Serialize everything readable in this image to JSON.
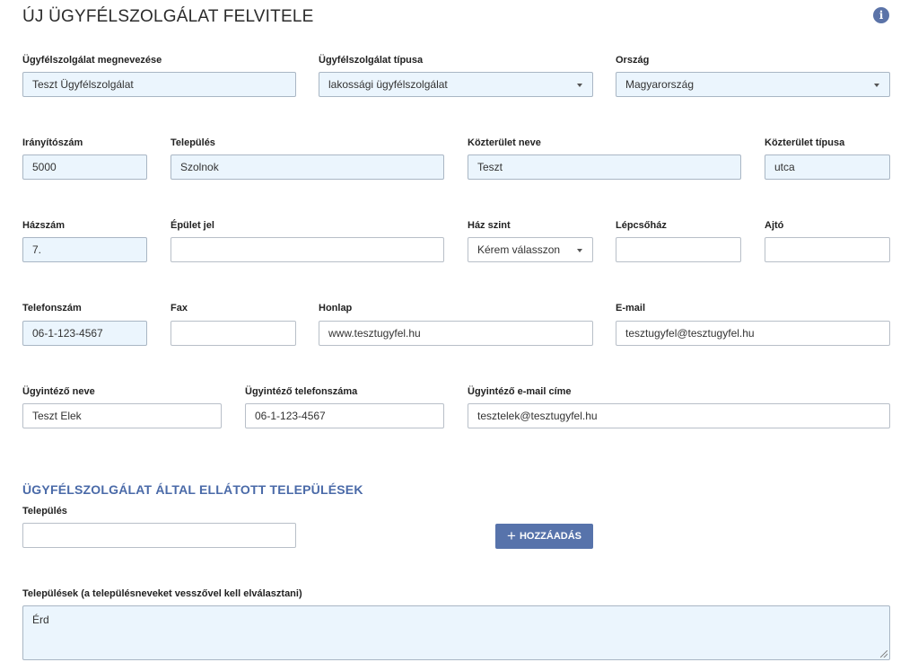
{
  "header": {
    "title": "ÚJ ÜGYFÉLSZOLGÁLAT FELVITELE",
    "info_icon": "info-icon",
    "info_glyph": "i"
  },
  "form": {
    "name": {
      "label": "Ügyfélszolgálat megnevezése",
      "value": "Teszt Ügyfélszolgálat"
    },
    "type": {
      "label": "Ügyfélszolgálat típusa",
      "value": "lakossági ügyfélszolgálat"
    },
    "country": {
      "label": "Ország",
      "value": "Magyarország"
    },
    "zip": {
      "label": "Irányítószám",
      "value": "5000"
    },
    "city": {
      "label": "Település",
      "value": "Szolnok"
    },
    "street_name": {
      "label": "Közterület neve",
      "value": "Teszt"
    },
    "street_type": {
      "label": "Közterület típusa",
      "value": "utca"
    },
    "house_number": {
      "label": "Házszám",
      "value": "7."
    },
    "building": {
      "label": "Épület jel",
      "value": ""
    },
    "floor": {
      "label": "Ház szint",
      "value": "Kérem válasszon"
    },
    "staircase": {
      "label": "Lépcsőház",
      "value": ""
    },
    "door": {
      "label": "Ajtó",
      "value": ""
    },
    "phone": {
      "label": "Telefonszám",
      "value": "06-1-123-4567"
    },
    "fax": {
      "label": "Fax",
      "value": ""
    },
    "website": {
      "label": "Honlap",
      "value": "www.tesztugyfel.hu"
    },
    "email": {
      "label": "E-mail",
      "value": "tesztugyfel@tesztugyfel.hu"
    },
    "agent_name": {
      "label": "Ügyintéző neve",
      "value": "Teszt Elek"
    },
    "agent_phone": {
      "label": "Ügyintéző telefonszáma",
      "value": "06-1-123-4567"
    },
    "agent_email": {
      "label": "Ügyintéző e-mail címe",
      "value": "tesztelek@tesztugyfel.hu"
    }
  },
  "settlements": {
    "section_title": "ÜGYFÉLSZOLGÁLAT ÁLTAL ELLÁTOTT TELEPÜLÉSEK",
    "city_label": "Település",
    "city_value": "",
    "add_button_label": "HOZZÁADÁS",
    "add_icon": "plus-icon",
    "add_glyph": "+",
    "list_label": "Települések (a településneveket vesszővel kell elválasztani)",
    "list_value": "Érd"
  },
  "colors": {
    "accent": "#5773ab",
    "section_title": "#4a6aa8",
    "filled_input_bg": "#ebf5fd"
  }
}
